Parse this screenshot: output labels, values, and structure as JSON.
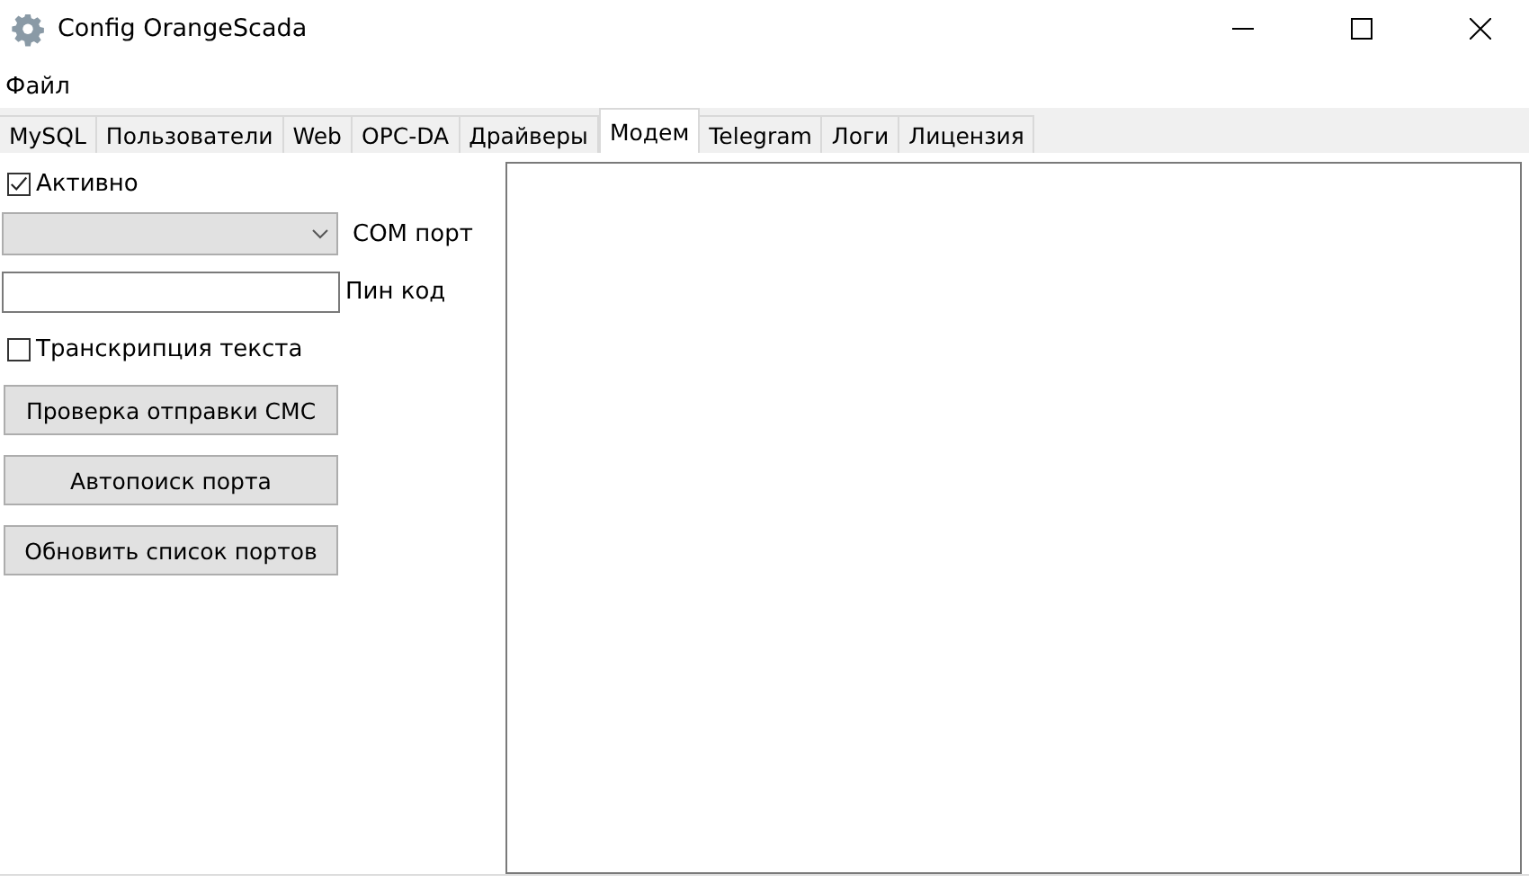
{
  "window": {
    "title": "Config OrangeScada"
  },
  "menu": [
    "Файл"
  ],
  "tabs": [
    {
      "label": "MySQL",
      "selected": false
    },
    {
      "label": "Пользователи",
      "selected": false
    },
    {
      "label": "Web",
      "selected": false
    },
    {
      "label": "OPC-DA",
      "selected": false
    },
    {
      "label": "Драйверы",
      "selected": false
    },
    {
      "label": "Модем",
      "selected": true
    },
    {
      "label": "Telegram",
      "selected": false
    },
    {
      "label": "Логи",
      "selected": false
    },
    {
      "label": "Лицензия",
      "selected": false
    }
  ],
  "modem": {
    "active": {
      "label": "Активно",
      "checked": true
    },
    "com_port": {
      "label": "COM порт"
    },
    "pin": {
      "label": "Пин код"
    },
    "transcription": {
      "label": "Транскрипция текста",
      "checked": false
    },
    "buttons": [
      "Проверка отправки СМС",
      "Автопоиск порта",
      "Обновить список портов"
    ]
  }
}
